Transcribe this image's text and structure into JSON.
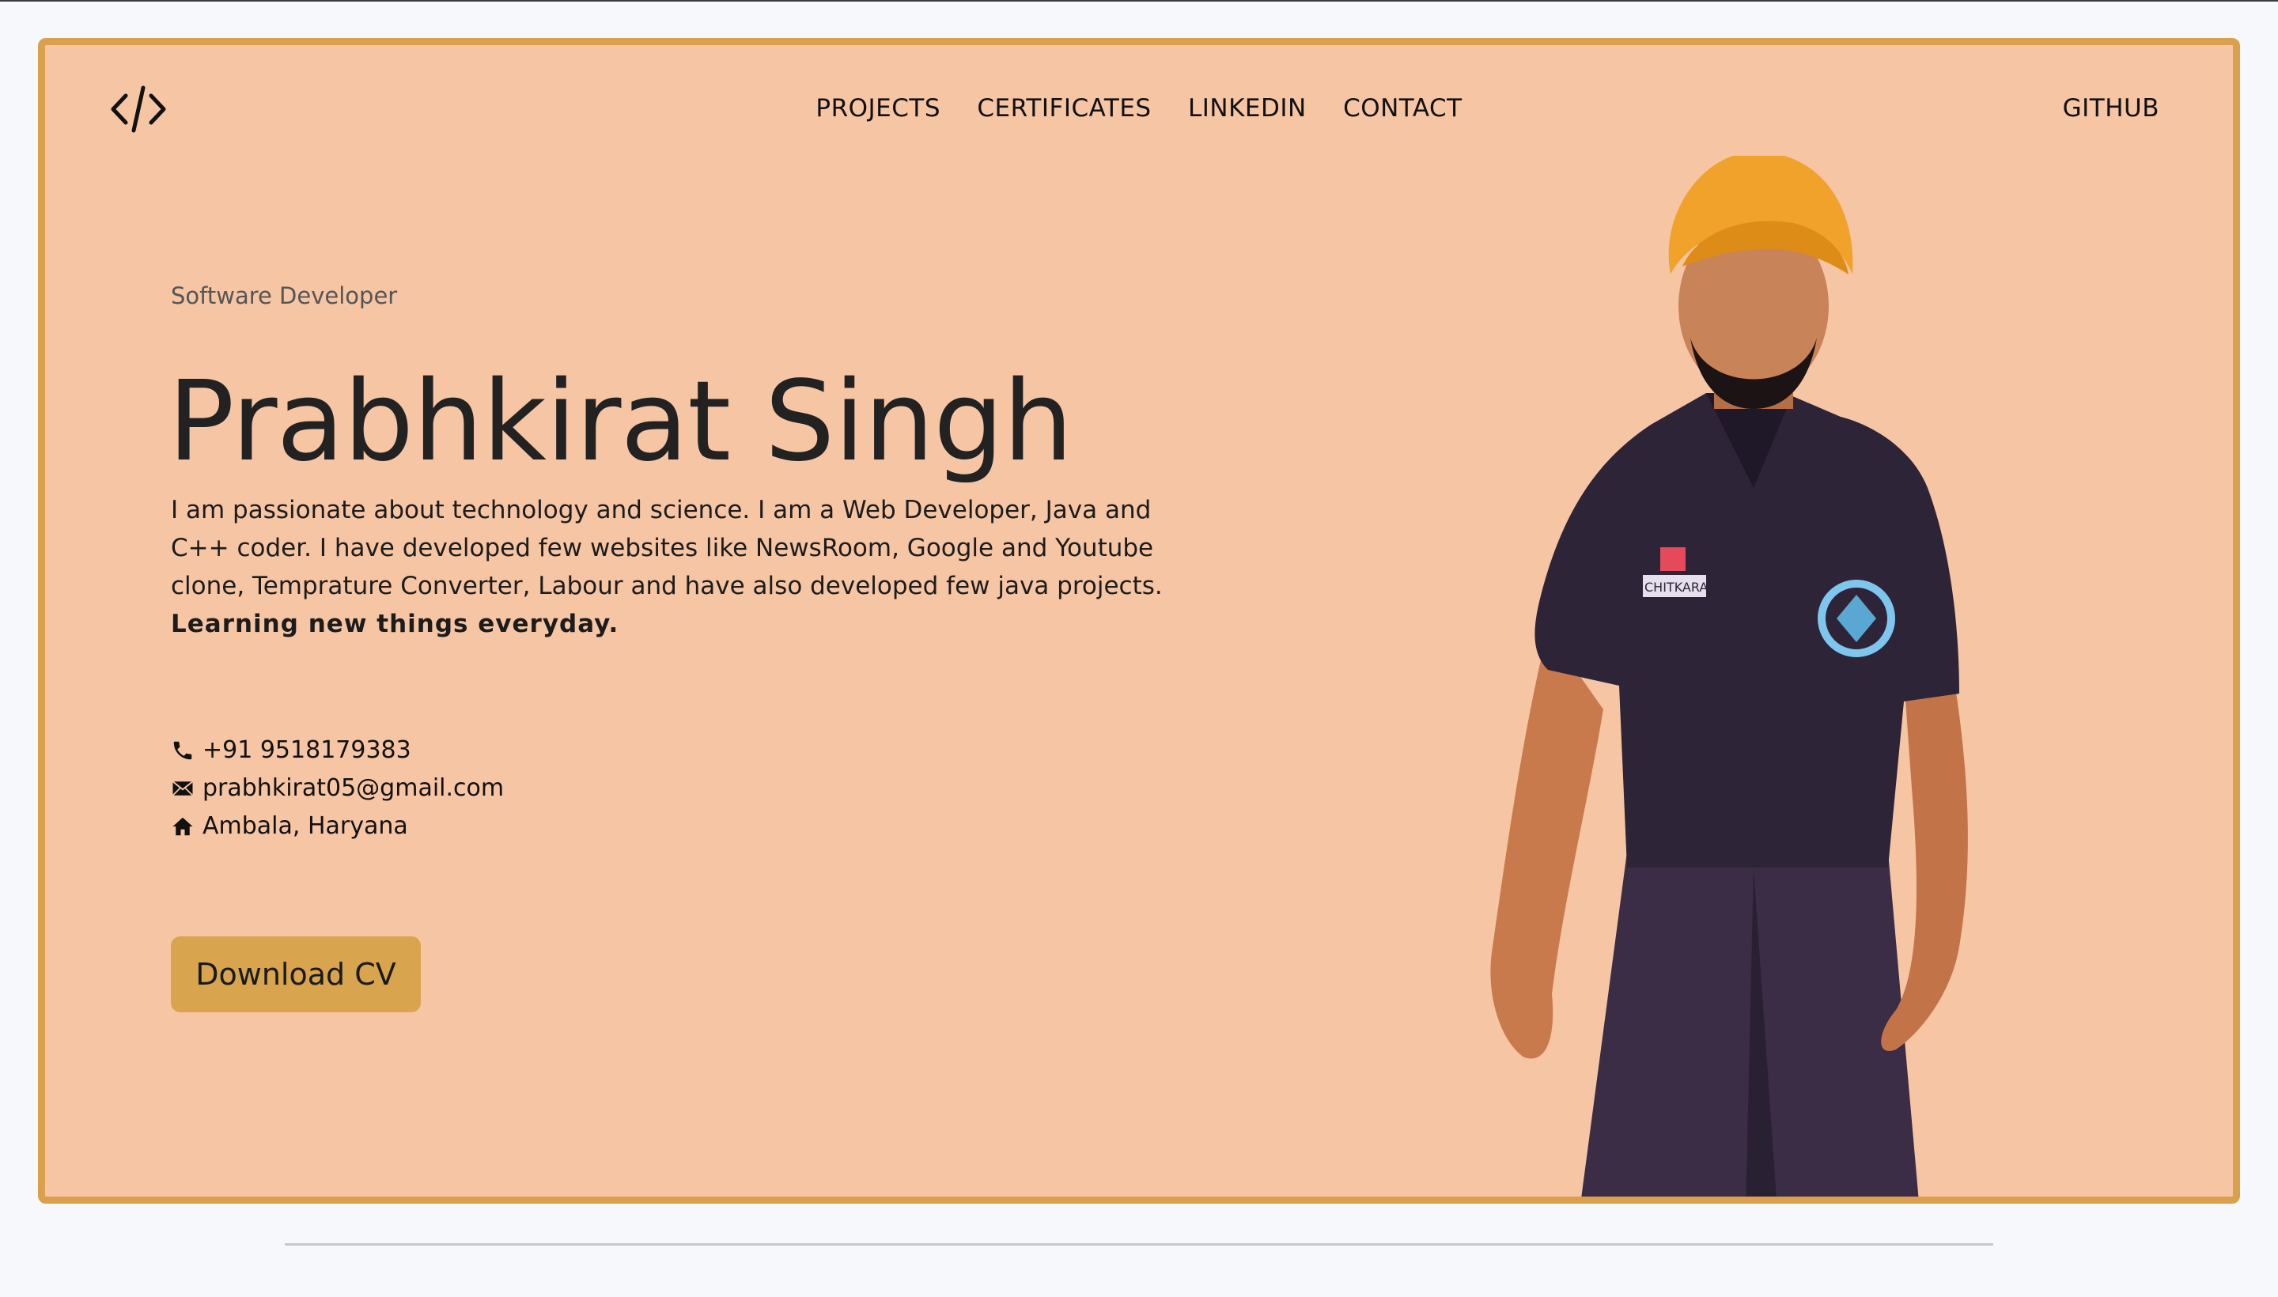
{
  "nav": {
    "logo_icon": "code-brackets-icon",
    "items": [
      {
        "label": "PROJECTS"
      },
      {
        "label": "CERTIFICATES"
      },
      {
        "label": "LINKEDIN"
      },
      {
        "label": "CONTACT"
      }
    ],
    "github_label": "GITHUB"
  },
  "hero": {
    "role": "Software Developer",
    "name": "Prabhkirat Singh",
    "bio_text": "I am passionate about technology and science. I am a Web Developer, Java and C++ coder. I have developed few websites like NewsRoom, Google and Youtube clone, Temprature Converter, Labour and have also developed few java projects.",
    "bio_strong": "Learning new things everyday.",
    "contact": {
      "phone": "+91 9518179383",
      "email": "prabhkirat05@gmail.com",
      "location": "Ambala, Haryana"
    },
    "cv_button": "Download CV",
    "portrait_badge_text": "CHITKARA"
  },
  "colors": {
    "page_bg": "#f7f8fb",
    "hero_bg": "#f6c5a4",
    "hero_border": "#dba04c",
    "button_bg": "#d8a44e",
    "turban": "#f0a22a",
    "shirt": "#2e2438"
  }
}
